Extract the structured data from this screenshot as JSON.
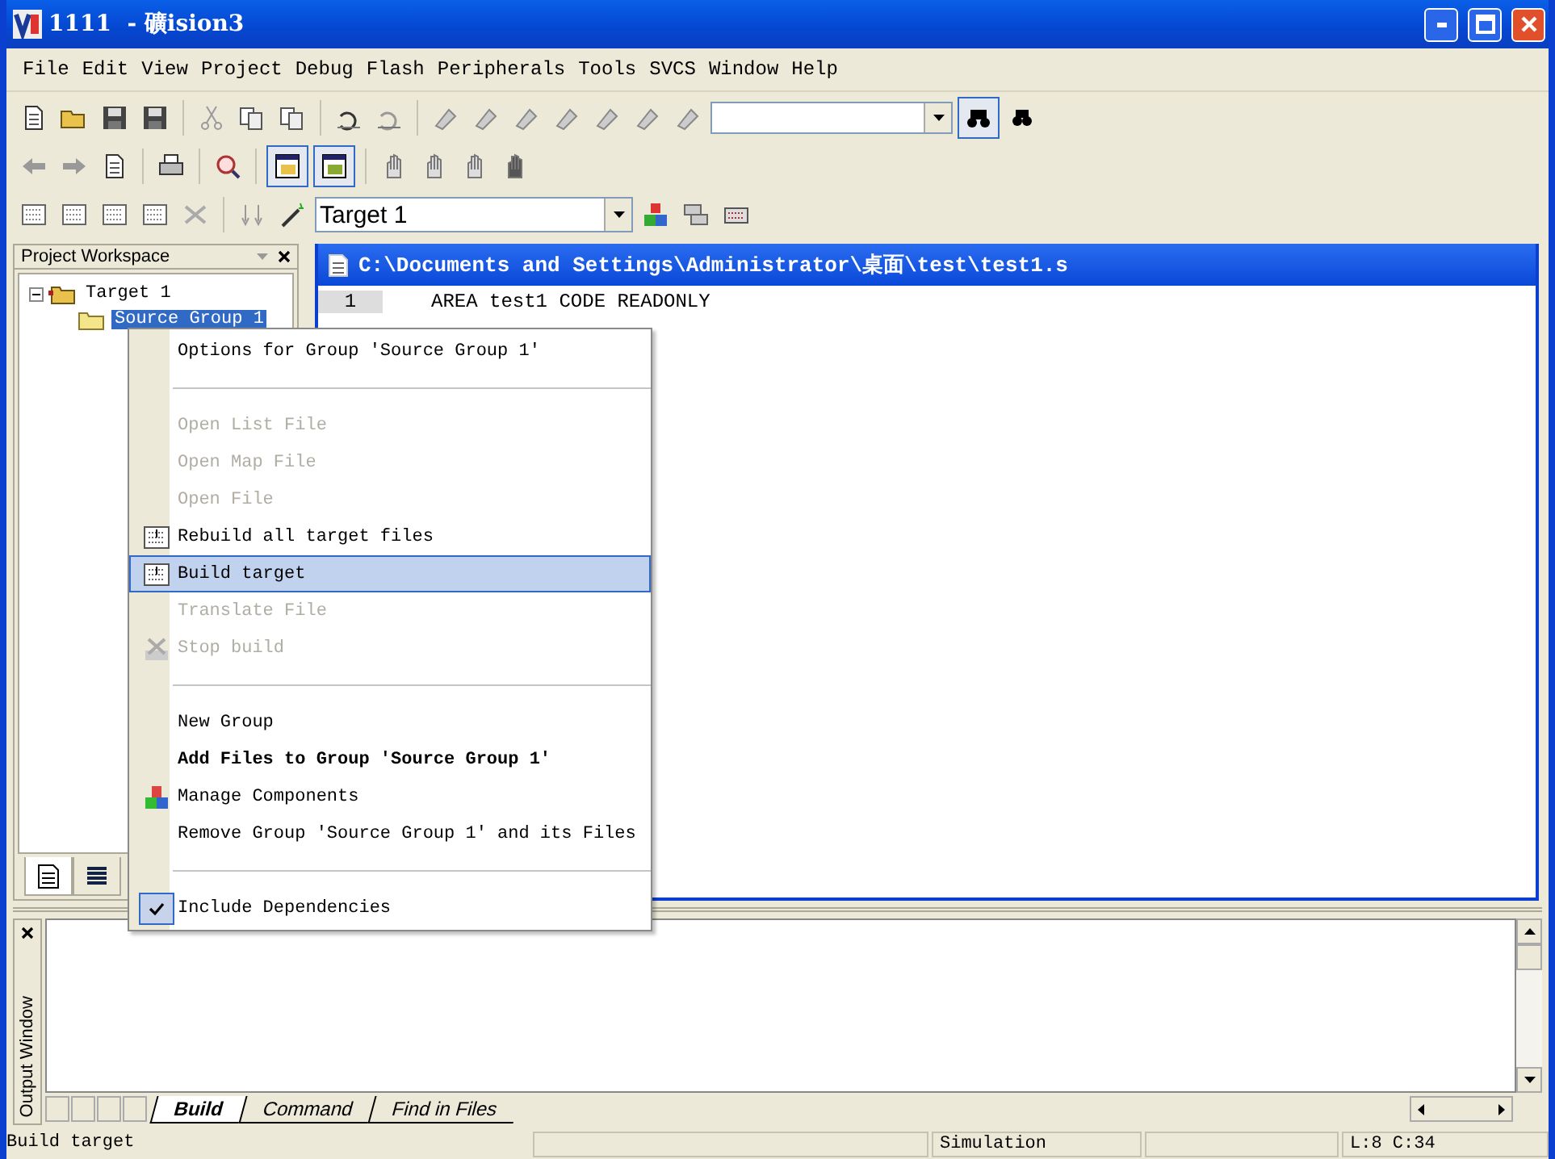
{
  "window": {
    "title": "1111  - 礦ision3"
  },
  "menu_bar": [
    "File",
    "Edit",
    "View",
    "Project",
    "Debug",
    "Flash",
    "Peripherals",
    "Tools",
    "SVCS",
    "Window",
    "Help"
  ],
  "toolbar": {
    "target_combo": {
      "value": "Target 1"
    }
  },
  "workspace": {
    "title": "Project Workspace",
    "tree": [
      {
        "label": "Target 1",
        "expanded": true,
        "selected": false,
        "children": [
          {
            "label": "Source Group 1",
            "selected": true
          }
        ]
      }
    ],
    "tabs": [
      {
        "selected": true
      },
      {
        "selected": false
      }
    ]
  },
  "editor": {
    "path": "C:\\Documents and Settings\\Administrator\\桌面\\test\\test1.s",
    "lines": [
      {
        "number": "1",
        "text": "AREA test1 CODE READONLY"
      }
    ]
  },
  "context_menu": [
    {
      "kind": "item",
      "label": "Options for Group 'Source Group 1'",
      "disabled": false,
      "selected": false
    },
    {
      "kind": "separator"
    },
    {
      "kind": "item",
      "label": "Open List File",
      "disabled": true,
      "selected": false
    },
    {
      "kind": "item",
      "label": "Open Map File",
      "disabled": true,
      "selected": false
    },
    {
      "kind": "item",
      "label": "Open File",
      "disabled": true,
      "selected": false
    },
    {
      "kind": "item",
      "label": "Rebuild all target files",
      "disabled": false,
      "selected": false
    },
    {
      "kind": "item",
      "label": "Build target",
      "disabled": false,
      "selected": true
    },
    {
      "kind": "item",
      "label": "Translate File",
      "disabled": true,
      "selected": false
    },
    {
      "kind": "item",
      "label": "Stop build",
      "disabled": true,
      "selected": false
    },
    {
      "kind": "separator"
    },
    {
      "kind": "item",
      "label": "New Group",
      "disabled": false,
      "selected": false
    },
    {
      "kind": "item",
      "label": "Add Files to Group 'Source Group 1'",
      "disabled": false,
      "bold": true,
      "selected": false
    },
    {
      "kind": "item",
      "label": "Manage Components",
      "disabled": false,
      "selected": false
    },
    {
      "kind": "item",
      "label": "Remove Group 'Source Group 1' and its Files",
      "disabled": false,
      "selected": false
    },
    {
      "kind": "separator"
    },
    {
      "kind": "item",
      "label": "Include Dependencies",
      "disabled": false,
      "selected": false,
      "checked": true
    }
  ],
  "output": {
    "title": "Output Window",
    "tabs": [
      {
        "label": "Build",
        "selected": true
      },
      {
        "label": "Command",
        "selected": false
      },
      {
        "label": "Find in Files",
        "selected": false
      }
    ]
  },
  "status_bar": [
    "Build target",
    "Simulation",
    "L:8 C:34"
  ]
}
